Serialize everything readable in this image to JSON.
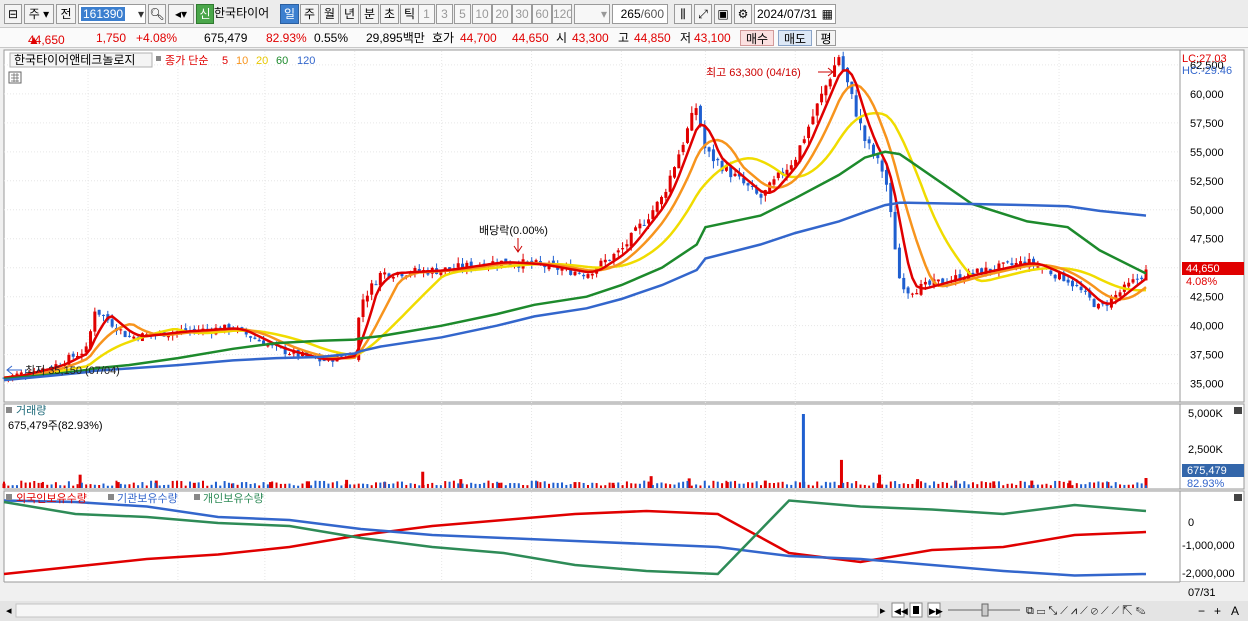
{
  "toolbar": {
    "market": "주",
    "period_mode": "전",
    "code": "161390",
    "credit_badge": "신",
    "stock_name": "한국타이어",
    "periods": [
      "일",
      "주",
      "월",
      "년",
      "분",
      "초",
      "틱"
    ],
    "active_period": "일",
    "intervals": [
      "1",
      "3",
      "5",
      "10",
      "20",
      "30",
      "60",
      "120"
    ],
    "count_shown": "265",
    "count_total": "/600",
    "date": "2024/07/31"
  },
  "quote": {
    "price": "44,650",
    "arrow": "▲",
    "change": "1,750",
    "change_pct": "+4.08%",
    "volume": "675,479",
    "volume_ratio": "82.93%",
    "turnover_rate": "0.55%",
    "amount": "29,895백만",
    "ask_label": "호가",
    "ask": "44,700",
    "bid": "44,650",
    "open_label": "시",
    "open": "43,300",
    "high_label": "고",
    "high": "44,850",
    "low_label": "저",
    "low": "43,100",
    "buy": "매수",
    "sell": "매도",
    "eval": "평"
  },
  "price_pane": {
    "stock_label": "한국타이어앤테크놀로지",
    "ma_label": "종가 단순",
    "ma_periods": [
      {
        "n": "5",
        "color": "#e00000"
      },
      {
        "n": "10",
        "color": "#f7941d"
      },
      {
        "n": "20",
        "color": "#f0dc00"
      },
      {
        "n": "60",
        "color": "#1d8a2c"
      },
      {
        "n": "120",
        "color": "#3366cc"
      }
    ],
    "lc": "LC:27.03",
    "hc": "HC:-29.46",
    "y_ticks": [
      "62,500",
      "60,000",
      "57,500",
      "55,000",
      "52,500",
      "50,000",
      "47,500",
      "45,000",
      "42,500",
      "40,000",
      "37,500",
      "35,000"
    ],
    "current_price": "44,650",
    "current_pct": "4.08%",
    "high_annotation": "최고 63,300 (04/16)",
    "low_annotation": "최저 35,150 (07/04)",
    "dividend_annotation": "배당락(0.00%)"
  },
  "volume_pane": {
    "title": "거래량",
    "value": "675,479주(82.93%)",
    "y_ticks": [
      "5,000K",
      "2,500K"
    ],
    "current": "675,479",
    "current_pct": "82.93%"
  },
  "holding_pane": {
    "series": [
      {
        "name": "외국인보유수량",
        "color": "#e00000"
      },
      {
        "name": "기관보유수량",
        "color": "#3366cc"
      },
      {
        "name": "개인보유수량",
        "color": "#2e8b57"
      }
    ],
    "y_ticks": [
      "0",
      "-1,000,000",
      "-2,000,000"
    ]
  },
  "x_axis": {
    "labels": [
      "2023/07",
      "08",
      "09",
      "10",
      "11",
      "12",
      "2024/01",
      "02",
      "03",
      "04",
      "05",
      "06",
      "07"
    ],
    "right_label": "07/31"
  },
  "chart_data": {
    "type": "line",
    "title": "한국타이어앤테크놀로지",
    "x": [
      "2023/07/03",
      "2023/07/20",
      "2023/08/01",
      "2023/08/03",
      "2023/08/15",
      "2023/09/01",
      "2023/09/20",
      "2023/10/05",
      "2023/10/20",
      "2023/11/01",
      "2023/11/03",
      "2023/11/10",
      "2023/12/01",
      "2023/12/20",
      "2024/01/02",
      "2024/01/20",
      "2024/02/01",
      "2024/02/15",
      "2024/02/27",
      "2024/03/01",
      "2024/03/20",
      "2024/04/01",
      "2024/04/16",
      "2024/04/25",
      "2024/05/02",
      "2024/05/07",
      "2024/05/10",
      "2024/06/01",
      "2024/06/20",
      "2024/07/04",
      "2024/07/15",
      "2024/07/31"
    ],
    "series": [
      {
        "name": "종가",
        "values": [
          35500,
          36500,
          38000,
          41500,
          39000,
          39500,
          39800,
          38000,
          37000,
          37500,
          42000,
          44500,
          44800,
          45500,
          45300,
          44500,
          46500,
          51000,
          59000,
          55000,
          51000,
          54500,
          63300,
          56000,
          53000,
          44000,
          43000,
          44500,
          45500,
          44000,
          41500,
          44650
        ]
      },
      {
        "name": "120",
        "values": [
          35300,
          35700,
          36000,
          36100,
          36300,
          36600,
          37000,
          37200,
          37300,
          37600,
          37800,
          38200,
          39000,
          40000,
          40800,
          41500,
          42300,
          43500,
          44800,
          45800,
          47000,
          48000,
          49000,
          49800,
          50400,
          50600,
          50600,
          50500,
          50400,
          50300,
          49900,
          49500
        ]
      },
      {
        "name": "60",
        "values": [
          35400,
          35800,
          36200,
          36300,
          36600,
          37200,
          38000,
          38500,
          38700,
          38800,
          38900,
          39100,
          40000,
          41000,
          41800,
          42500,
          43500,
          45000,
          47000,
          48500,
          49500,
          51000,
          53000,
          54500,
          55000,
          54800,
          54300,
          50500,
          49000,
          48500,
          46500,
          44500
        ]
      }
    ],
    "ylim": [
      33500,
      63700
    ]
  },
  "volume_chart": {
    "values": [
      300,
      350,
      900,
      400,
      500,
      350,
      300,
      400,
      450,
      550,
      400,
      1100,
      600,
      350,
      450,
      400,
      350,
      800,
      650,
      400,
      500,
      5000,
      1900,
      900,
      600,
      500,
      450,
      500,
      500,
      400,
      675
    ]
  },
  "holding_chart": {
    "foreign": [
      -2100000,
      -1850000,
      -1600000,
      -1450000,
      -1200000,
      -800000,
      -500000,
      -300000,
      -100000,
      0,
      -100000,
      -1400000,
      -1700000,
      -1300000,
      -1200000,
      -800000,
      -700000
    ],
    "institution": [
      350000,
      300000,
      150000,
      -200000,
      -300000,
      -600000,
      -800000,
      -900000,
      -1000000,
      -1100000,
      -1200000,
      -1500000,
      -1600000,
      -1800000,
      -2000000,
      -2150000,
      -2100000
    ],
    "individual": [
      300000,
      -100000,
      -200000,
      -400000,
      -500000,
      -900000,
      -1200000,
      -1400000,
      -1800000,
      -2000000,
      -2100000,
      350000,
      150000,
      50000,
      -100000,
      200000,
      0
    ]
  }
}
